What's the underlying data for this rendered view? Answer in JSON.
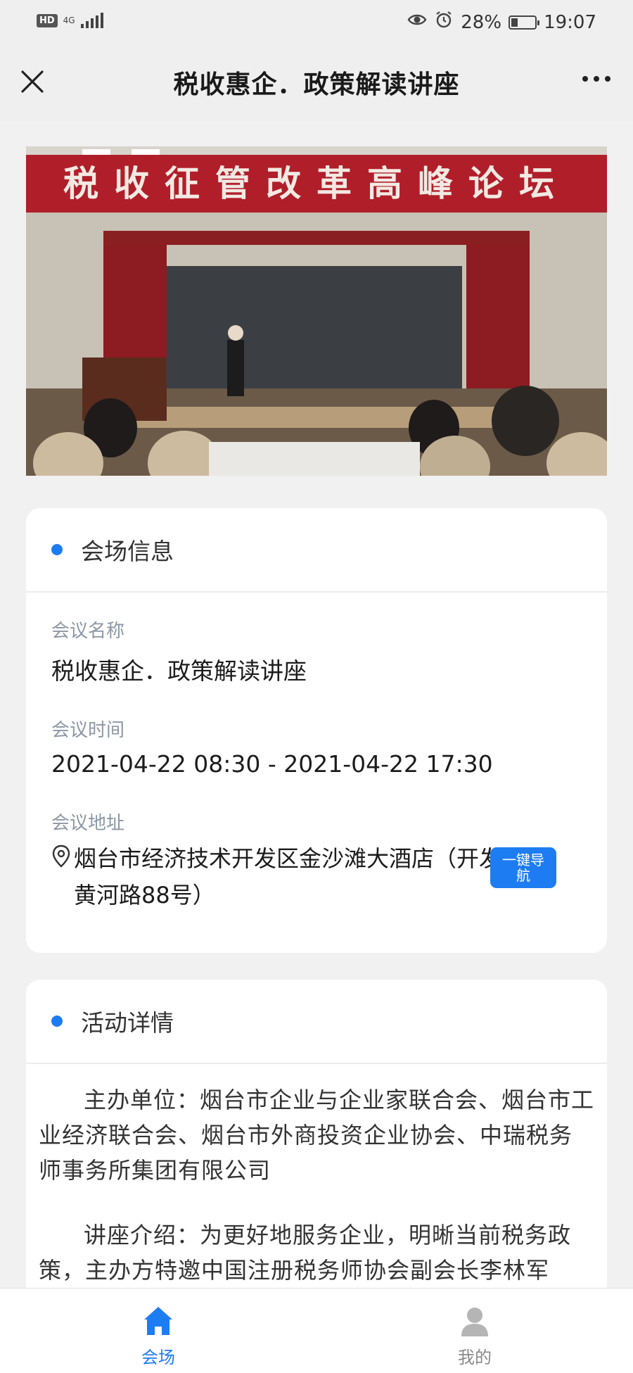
{
  "status_bar": {
    "hd": "HD",
    "network": "4G",
    "battery_percent": "28%",
    "battery_level": 0.28,
    "time": "19:07"
  },
  "nav": {
    "title": "税收惠企．政策解读讲座",
    "close_icon": "close-icon",
    "more_icon": "more-dots-icon"
  },
  "banner": {
    "caption": "税收征管改革高峰论坛"
  },
  "venue_card": {
    "title": "会场信息",
    "name_label": "会议名称",
    "name_value": "税收惠企．政策解读讲座",
    "time_label": "会议时间",
    "time_value": "2021-04-22 08:30 - 2021-04-22 17:30",
    "address_label": "会议地址",
    "address_value": "烟台市经济技术开发区金沙滩大酒店（开发区黄河路88号）",
    "nav_button": "一键导航"
  },
  "detail_card": {
    "title": "活动详情",
    "paragraphs": [
      "主办单位：烟台市企业与企业家联合会、烟台市工业经济联合会、烟台市外商投资企业协会、中瑞税务师事务所集团有限公司",
      "讲座介绍：为更好地服务企业，明晰当前税务政策，主办方特邀中国注册税务师协会副会长李林军"
    ]
  },
  "tab_bar": {
    "tabs": [
      {
        "label": "会场",
        "icon": "home-icon",
        "active": true
      },
      {
        "label": "我的",
        "icon": "user-icon",
        "active": false
      }
    ]
  },
  "colors": {
    "accent": "#1e7cf2",
    "background": "#f1f1f1"
  }
}
